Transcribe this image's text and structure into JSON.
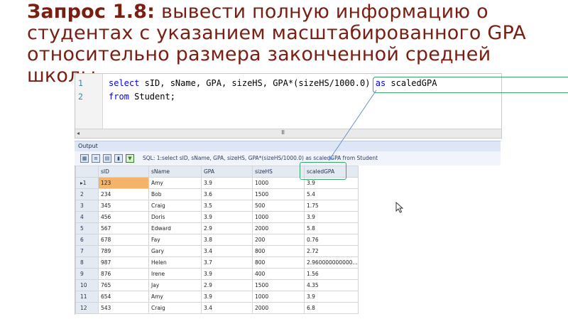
{
  "title": {
    "bold": "Запрос 1.8:",
    "rest_line1": " вывести полную информацию о",
    "line2": "студентах  с указанием масштабированного GPA",
    "line3": "относительно размера законченной средней",
    "line4": "школы"
  },
  "editor": {
    "line_numbers": [
      "1",
      "2"
    ],
    "line1": {
      "kw_select": "select",
      "cols": " sID, sName, GPA, sizeHS, ",
      "expr": "GPA*(sizeHS/",
      "num": "1000.0",
      "expr_end": ") ",
      "kw_as": "as",
      "alias": " scaledGPA"
    },
    "line2": {
      "kw_from": "from",
      "table": " Student;"
    },
    "scroll_grip": "III"
  },
  "output": {
    "label": "Output",
    "sql_text": "SQL: 1:select sID, sName, GPA, sizeHS, GPA*(sizeHS/1000.0) as scaledGPA  from Student"
  },
  "grid": {
    "columns": [
      "sID",
      "sName",
      "GPA",
      "sizeHS",
      "scaledGPA"
    ],
    "rows": [
      {
        "n": "▸1",
        "sID": "123",
        "sName": "Amy",
        "GPA": "3.9",
        "sizeHS": "1000",
        "scaledGPA": "3.9"
      },
      {
        "n": "2",
        "sID": "234",
        "sName": "Bob",
        "GPA": "3.6",
        "sizeHS": "1500",
        "scaledGPA": "5.4"
      },
      {
        "n": "3",
        "sID": "345",
        "sName": "Craig",
        "GPA": "3.5",
        "sizeHS": "500",
        "scaledGPA": "1.75"
      },
      {
        "n": "4",
        "sID": "456",
        "sName": "Doris",
        "GPA": "3.9",
        "sizeHS": "1000",
        "scaledGPA": "3.9"
      },
      {
        "n": "5",
        "sID": "567",
        "sName": "Edward",
        "GPA": "2.9",
        "sizeHS": "2000",
        "scaledGPA": "5.8"
      },
      {
        "n": "6",
        "sID": "678",
        "sName": "Fay",
        "GPA": "3.8",
        "sizeHS": "200",
        "scaledGPA": "0.76"
      },
      {
        "n": "7",
        "sID": "789",
        "sName": "Gary",
        "GPA": "3.4",
        "sizeHS": "800",
        "scaledGPA": "2.72"
      },
      {
        "n": "8",
        "sID": "987",
        "sName": "Helen",
        "GPA": "3.7",
        "sizeHS": "800",
        "scaledGPA": "2.960000000000..."
      },
      {
        "n": "9",
        "sID": "876",
        "sName": "Irene",
        "GPA": "3.9",
        "sizeHS": "400",
        "scaledGPA": "1.56"
      },
      {
        "n": "10",
        "sID": "765",
        "sName": "Jay",
        "GPA": "2.9",
        "sizeHS": "1500",
        "scaledGPA": "4.35"
      },
      {
        "n": "11",
        "sID": "654",
        "sName": "Amy",
        "GPA": "3.9",
        "sizeHS": "1000",
        "scaledGPA": "3.9"
      },
      {
        "n": "12",
        "sID": "543",
        "sName": "Craig",
        "GPA": "3.4",
        "sizeHS": "2000",
        "scaledGPA": "6.8"
      }
    ]
  },
  "colors": {
    "title": "#7a1e12",
    "highlight_box": "#3aa86b",
    "arrow": "#6a8fd0",
    "selected_cell": "#f5b36a"
  }
}
